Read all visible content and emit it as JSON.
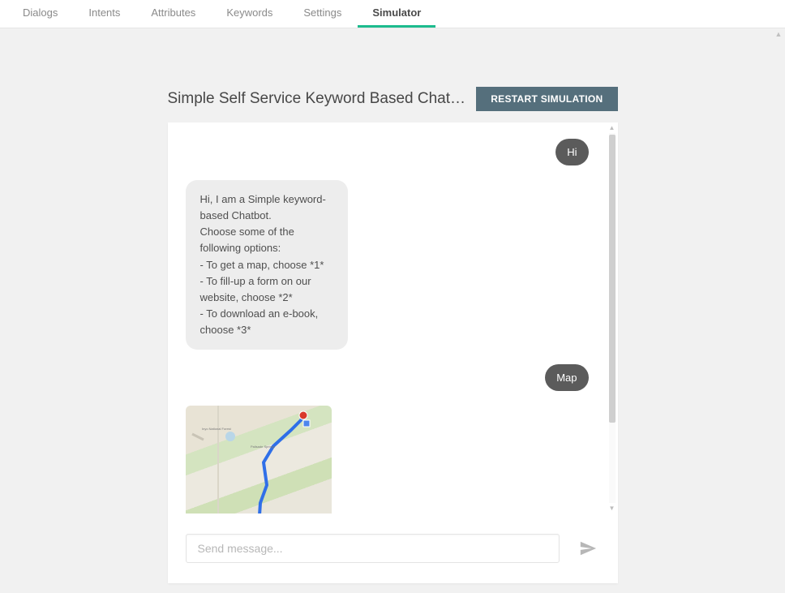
{
  "tabs": [
    {
      "label": "Dialogs",
      "active": false
    },
    {
      "label": "Intents",
      "active": false
    },
    {
      "label": "Attributes",
      "active": false
    },
    {
      "label": "Keywords",
      "active": false
    },
    {
      "label": "Settings",
      "active": false
    },
    {
      "label": "Simulator",
      "active": true
    }
  ],
  "page_title": "Simple Self Service Keyword Based Chatbot (USECA…",
  "restart_label": "RESTART SIMULATION",
  "messages": [
    {
      "role": "user",
      "text": "Hi"
    },
    {
      "role": "bot",
      "text": "Hi, I am a Simple keyword-based Chatbot.\nChoose some of the following options:\n- To get a map, choose *1*\n- To fill-up a form on our website, choose *2*\n- To download an e-book, choose *3*"
    },
    {
      "role": "user",
      "text": "Map"
    },
    {
      "role": "bot",
      "type": "map"
    }
  ],
  "composer": {
    "placeholder": "Send message...",
    "value": ""
  }
}
